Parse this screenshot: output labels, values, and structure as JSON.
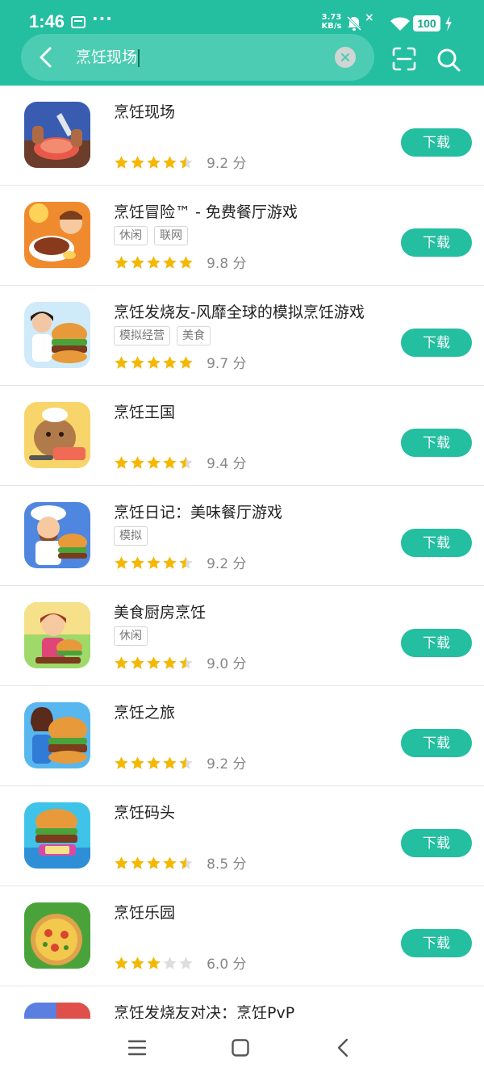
{
  "status_bar": {
    "time": "1:46",
    "more": "···",
    "net_speed_value": "3.73",
    "net_speed_unit": "KB/s",
    "battery": "100"
  },
  "search": {
    "query": "烹饪现场"
  },
  "colors": {
    "accent": "#24bea0",
    "star": "#f5b800",
    "star_empty": "#dddddd"
  },
  "apps": [
    {
      "title": "烹饪现场",
      "tags": [],
      "rating": 4.5,
      "score": "9.2 分",
      "button": "下载"
    },
    {
      "title": "烹饪冒险™ - 免费餐厅游戏",
      "tags": [
        "休闲",
        "联网"
      ],
      "rating": 5,
      "score": "9.8 分",
      "button": "下载"
    },
    {
      "title": "烹饪发烧友-风靡全球的模拟烹饪游戏",
      "tags": [
        "模拟经营",
        "美食"
      ],
      "rating": 5,
      "score": "9.7 分",
      "button": "下载"
    },
    {
      "title": "烹饪王国",
      "tags": [],
      "rating": 4.5,
      "score": "9.4 分",
      "button": "下载"
    },
    {
      "title": "烹饪日记：美味餐厅游戏",
      "tags": [
        "模拟"
      ],
      "rating": 4.5,
      "score": "9.2 分",
      "button": "下载"
    },
    {
      "title": "美食厨房烹饪",
      "tags": [
        "休闲"
      ],
      "rating": 4.5,
      "score": "9.0 分",
      "button": "下载"
    },
    {
      "title": "烹饪之旅",
      "tags": [],
      "rating": 4.5,
      "score": "9.2 分",
      "button": "下载"
    },
    {
      "title": "烹饪码头",
      "tags": [],
      "rating": 4.5,
      "score": "8.5 分",
      "button": "下载"
    },
    {
      "title": "烹饪乐园",
      "tags": [],
      "rating": 3,
      "score": "6.0 分",
      "button": "下载"
    },
    {
      "title": "烹饪发烧友对决：烹饪PvP",
      "tags": [],
      "rating": 0,
      "score": "",
      "button": ""
    }
  ],
  "icons": {
    "back": "chevron-left-icon",
    "clear": "clear-icon",
    "scan": "scan-icon",
    "search": "search-icon",
    "nav_menu": "menu-icon",
    "nav_home": "home-icon",
    "nav_back": "back-icon"
  }
}
